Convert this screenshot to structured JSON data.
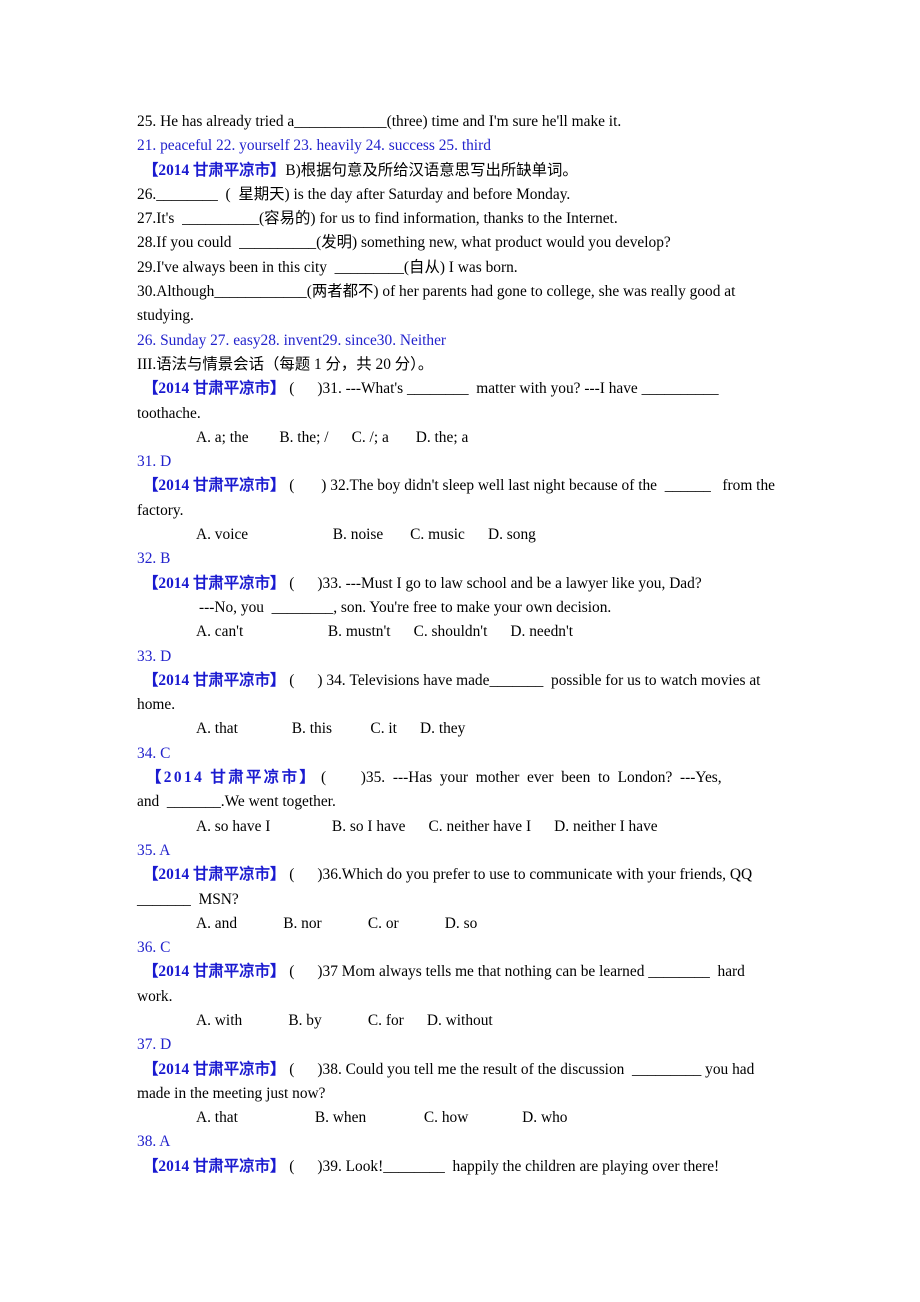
{
  "document": {
    "source_tag": "【2014 甘肃平凉市】",
    "lines": {
      "q25": "25. He has already tried a____________(three) time and I'm sure he'll make it.",
      "ans21_25": "21. peaceful 22. yourself 23. heavily 24. success 25. third",
      "section_b_instruction": "B)根据句意及所给汉语意思写出所缺单词。",
      "q26": "26.________  (  星期天) is the day after Saturday and before Monday.",
      "q27": "27.It's  __________(容易的) for us to find information, thanks to the Internet.",
      "q28": "28.If you could  __________(发明) something new, what product would you develop?",
      "q29": "29.I've always been in this city  _________(自从) I was born.",
      "q30a": "30.Although____________(两者都不) of her parents had gone to college, she was really good at",
      "q30b": "studying.",
      "ans26_30": "26. Sunday 27. easy28. invent29. since30. Neither",
      "section3_heading": "III.语法与情景会话（每题 1 分，共 20 分）。",
      "q31a": " (      )31. ---What's ________  matter with you? ---I have __________",
      "q31b": "toothache.",
      "q31_options": "A. a; the        B. the; /      C. /; a       D. the; a",
      "ans31": "31. D",
      "q32a": " (       ) 32.The boy didn't sleep well last night because of the  ______   from the",
      "q32b": "factory.",
      "q32_options": "A. voice                      B. noise       C. music      D. song",
      "ans32": "32. B",
      "q33a": " (      )33. ---Must I go to law school and be a lawyer like you, Dad?",
      "q33b": "---No, you  ________, son. You're free to make your own decision.",
      "q33_options": "A. can't                      B. mustn't      C. shouldn't      D. needn't",
      "ans33": "33. D",
      "q34a": " (      ) 34. Televisions have made_______  possible for us to watch movies at",
      "q34b": "home.",
      "q34_options": "A. that              B. this          C. it      D. they",
      "ans34": "34. C",
      "q35a": " (         )35.  ---Has  your  mother  ever  been  to  London?  ---Yes,",
      "q35b": "and  _______.We went together.",
      "q35_options": "A. so have I                B. so I have      C. neither have I      D. neither I have",
      "ans35": "35. A",
      "q36a": " (      )36.Which do you prefer to use to communicate with your friends, QQ",
      "q36b": "_______  MSN?",
      "q36_options": "A. and            B. nor            C. or            D. so",
      "ans36": "36. C",
      "q37a": " (      )37 Mom always tells me that nothing can be learned ________  hard",
      "q37b": "work.",
      "q37_options": "A. with            B. by            C. for      D. without",
      "ans37": "37. D",
      "q38a": " (      )38. Could you tell me the result of the discussion  _________ you had",
      "q38b": "made in the meeting just now?",
      "q38_options": "A. that                    B. when               C. how              D. who",
      "ans38": "38. A",
      "q39a": " (      )39. Look!________  happily the children are playing over there!"
    }
  }
}
